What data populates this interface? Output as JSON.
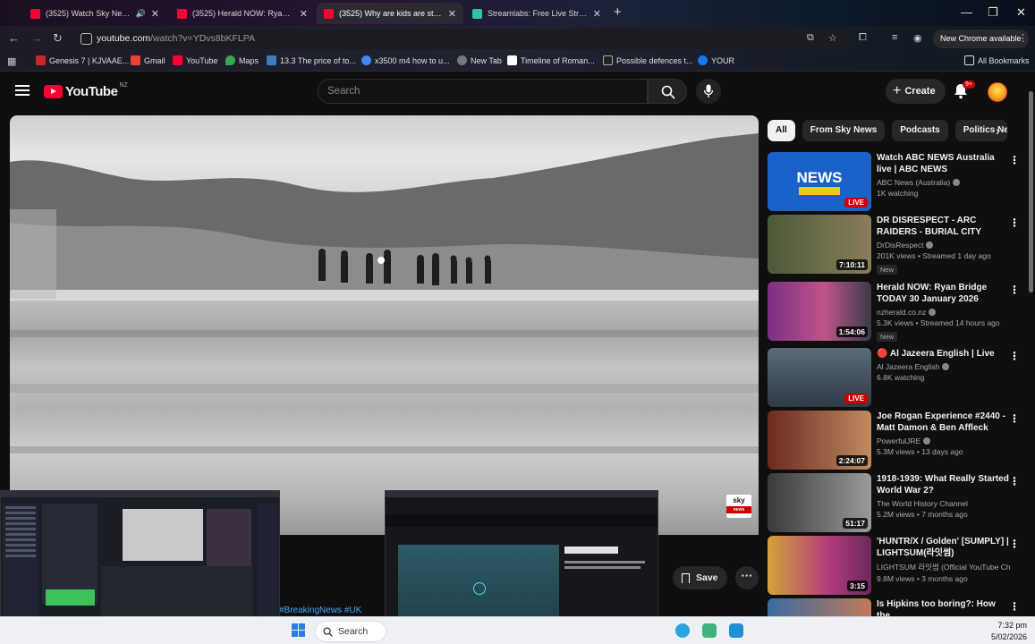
{
  "browser": {
    "tabs": [
      {
        "title": "(3525) Watch Sky News - Yo",
        "active": false,
        "audio": true
      },
      {
        "title": "(3525) Herald NOW: Ryan Bridg",
        "active": false
      },
      {
        "title": "(3525) Why are kids are still go",
        "active": true
      },
      {
        "title": "Streamlabs: Free Live Streaming",
        "active": false
      }
    ],
    "url_host": "youtube.com",
    "url_path": "/watch?v=YDvs8bKFLPA",
    "new_chrome_label": "New Chrome available",
    "bookmarks": [
      {
        "label": "Genesis 7 | KJVAAE...",
        "color": "#c62828"
      },
      {
        "label": "Gmail",
        "color": "#ea4335"
      },
      {
        "label": "YouTube",
        "color": "#ff0033"
      },
      {
        "label": "Maps",
        "color": "#34a853"
      },
      {
        "label": "13.3 The price of to...",
        "color": "#3c7ebf"
      },
      {
        "label": "x3500 m4 how to u...",
        "color": "#4285f4"
      },
      {
        "label": "New Tab",
        "color": "#777777"
      },
      {
        "label": "Timeline of Roman...",
        "color": "#ffffff"
      },
      {
        "label": "Possible defences t...",
        "color": "#222222"
      },
      {
        "label": "YOUR",
        "color": "#1877f2"
      }
    ],
    "all_bookmarks_label": "All Bookmarks"
  },
  "youtube": {
    "logo_text": "YouTube",
    "country_code": "NZ",
    "search_placeholder": "Search",
    "create_label": "Create",
    "notifications_badge": "9+",
    "hashtags": "#BreakingNews #UK",
    "save_label": "Save",
    "broadcaster_logo": {
      "line1": "sky",
      "line2": "news"
    },
    "chips": [
      "All",
      "From Sky News",
      "Podcasts",
      "Politics Ne"
    ],
    "recommendations": [
      {
        "title": "Watch ABC NEWS Australia live | ABC NEWS",
        "channel": "ABC News (Australia)",
        "stats": "1K watching",
        "badge": "LIVE",
        "thumb_color": "#1565c0"
      },
      {
        "title": "DR DISRESPECT - ARC RAIDERS - BURIAL CITY KILLAS",
        "channel": "DrDisRespect",
        "stats": "201K views • Streamed 1 day ago",
        "duration": "7:10:11",
        "new": "New",
        "thumb_color": "#5d6b4a"
      },
      {
        "title": "Herald NOW: Ryan Bridge TODAY 30 January 2026",
        "channel": "nzherald.co.nz",
        "stats": "5.3K views • Streamed 14 hours ago",
        "duration": "1:54:06",
        "new": "New",
        "thumb_color": "#7b2f86"
      },
      {
        "title": "🔴 Al Jazeera English | Live",
        "channel": "Al Jazeera English",
        "stats": "6.8K watching",
        "badge": "LIVE",
        "thumb_color": "#37474f"
      },
      {
        "title": "Joe Rogan Experience #2440 - Matt Damon & Ben Affleck",
        "channel": "PowerfulJRE",
        "stats": "5.3M views • 13 days ago",
        "duration": "2:24:07",
        "thumb_color": "#5a2e24"
      },
      {
        "title": "1918-1939: What Really Started World War 2?",
        "channel": "The World History Channel",
        "stats": "5.2M views • 7 months ago",
        "duration": "51:17",
        "thumb_color": "#6d6d6d"
      },
      {
        "title": "'HUNTR/X / Golden' [SUMPLY] | LIGHTSUM(라잇썸)",
        "channel": "LIGHTSUM 라잇썸 (Official YouTube Cha...",
        "stats": "9.8M views • 3 months ago",
        "duration": "3:15",
        "thumb_color": "#b03a7c"
      },
      {
        "title": "Is Hipkins too boring?: How the",
        "channel": "",
        "stats": "",
        "thumb_color": "#3b6aa0"
      }
    ]
  },
  "taskbar": {
    "search_label": "Search",
    "time": "7:32 pm",
    "date": "5/02/2026"
  },
  "thumbnail_previews": {
    "right_title": "TVNZ+",
    "right_heading": "1News at Six"
  }
}
